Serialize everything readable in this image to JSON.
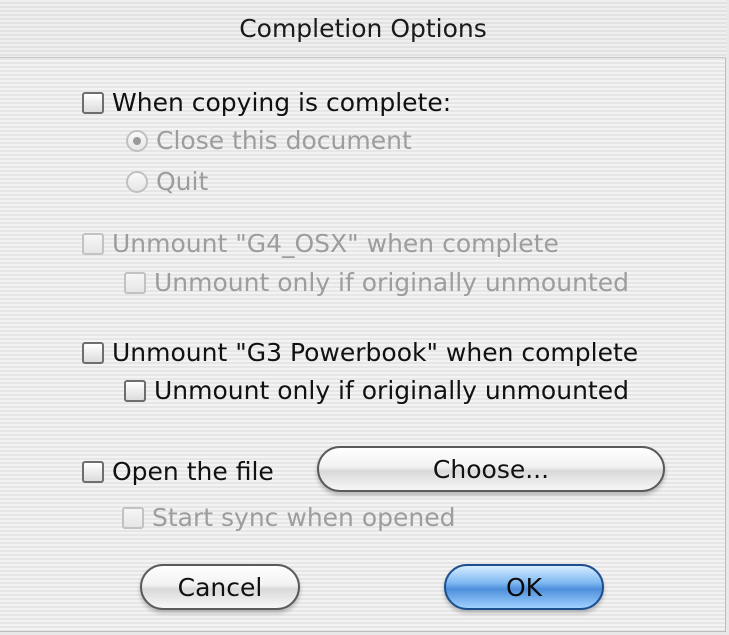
{
  "dialog": {
    "title": "Completion Options"
  },
  "options": {
    "when_copying": {
      "label": "When copying is complete:",
      "checked": false,
      "enabled": true
    },
    "radio_close": {
      "label": "Close this document",
      "selected": true,
      "enabled": false
    },
    "radio_quit": {
      "label": "Quit",
      "selected": false,
      "enabled": false
    },
    "unmount_g4": {
      "label": "Unmount \"G4_OSX\" when complete",
      "checked": false,
      "enabled": false
    },
    "unmount_g4_only": {
      "label": "Unmount only if originally unmounted",
      "checked": false,
      "enabled": false
    },
    "unmount_g3": {
      "label": "Unmount \"G3 Powerbook\" when complete",
      "checked": false,
      "enabled": true
    },
    "unmount_g3_only": {
      "label": "Unmount only if originally unmounted",
      "checked": false,
      "enabled": true
    },
    "open_file": {
      "label": "Open the file",
      "checked": false,
      "enabled": true
    },
    "start_sync": {
      "label": "Start sync when opened",
      "checked": false,
      "enabled": false
    }
  },
  "buttons": {
    "choose": "Choose...",
    "cancel": "Cancel",
    "ok": "OK"
  }
}
